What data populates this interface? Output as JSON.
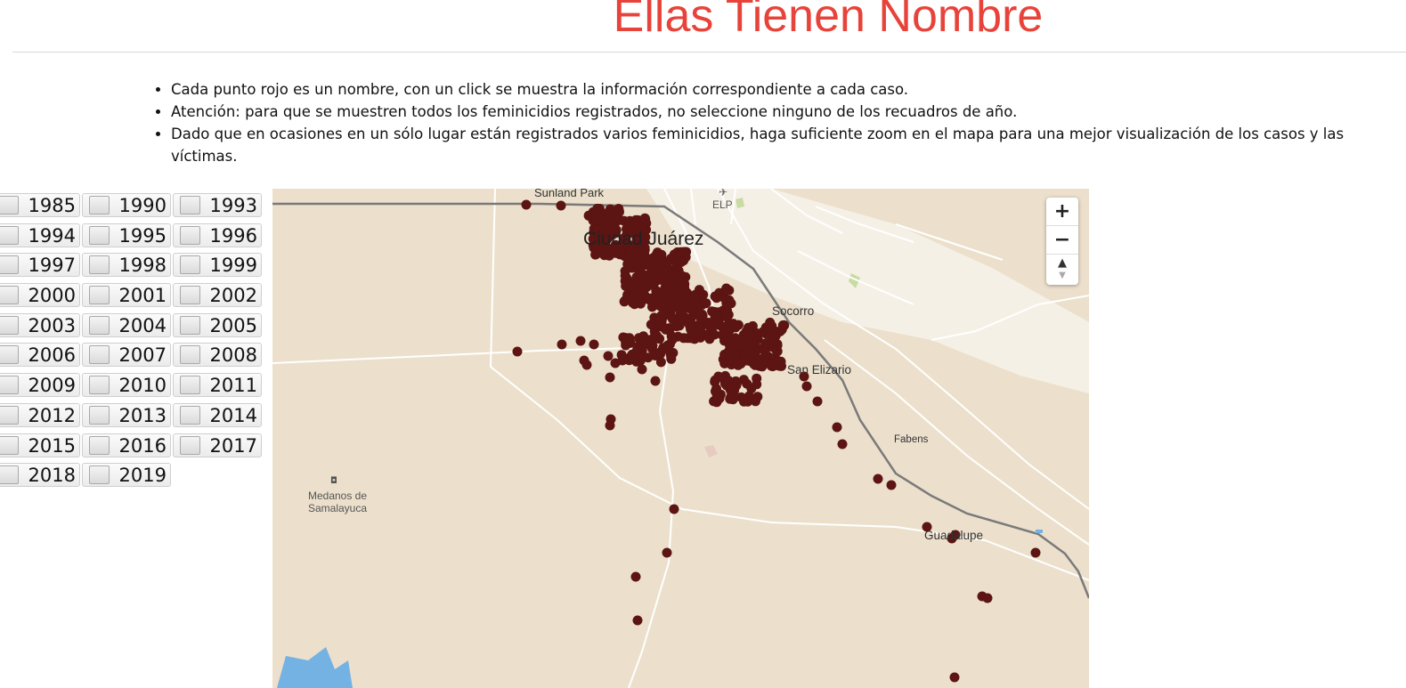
{
  "header": {
    "title": "Ellas Tienen Nombre"
  },
  "notes": [
    "Cada punto rojo es un nombre, con un click se muestra la información correspondiente a cada caso.",
    "Atención: para que se muestren todos los feminicidios registrados, no seleccione ninguno de los recuadros de año.",
    "Dado que en ocasiones en un sólo lugar están registrados varios feminicidios, haga suficiente zoom en el mapa para una mejor visualización de los casos y las víctimas."
  ],
  "years": [
    "1985",
    "1990",
    "1993",
    "1994",
    "1995",
    "1996",
    "1997",
    "1998",
    "1999",
    "2000",
    "2001",
    "2002",
    "2003",
    "2004",
    "2005",
    "2006",
    "2007",
    "2008",
    "2009",
    "2010",
    "2011",
    "2012",
    "2013",
    "2014",
    "2015",
    "2016",
    "2017",
    "2018",
    "2019"
  ],
  "map": {
    "labels": {
      "sunland_park": "Sunland Park",
      "elp": "ELP",
      "ciudad_juarez": "Ciudad Juárez",
      "socorro": "Socorro",
      "san_elizario": "San Elizario",
      "fabens": "Fabens",
      "guadalupe": "Guadalupe",
      "medanos": "Medanos de Samalayuca"
    },
    "zoom_in": "+",
    "zoom_out": "−",
    "reset_north": "▲",
    "colors": {
      "land": "#ece0cc",
      "urban": "#f5f0e6",
      "road": "#ffffff",
      "border": "#7a7a7a",
      "water": "#74b2e4",
      "park": "#c8dba3",
      "marker": "#5c1512"
    }
  }
}
